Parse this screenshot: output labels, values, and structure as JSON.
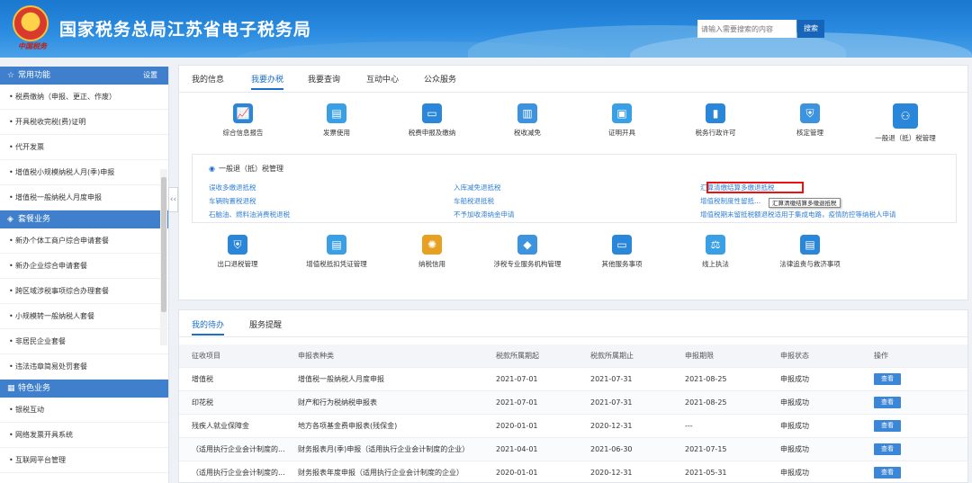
{
  "header": {
    "emblem_text": "中国税务",
    "title": "国家税务总局江苏省电子税务局",
    "search_placeholder": "请输入需要搜索的内容",
    "search_button": "搜索"
  },
  "sidebar": {
    "sections": [
      {
        "title": "常用功能",
        "right": "设置",
        "icon": "star-icon",
        "items": [
          "税费缴纳（申报、更正、作废）",
          "开具税收完税(费)证明",
          "代开发票",
          "增值税小规模纳税人月(季)申报",
          "增值税一般纳税人月度申报"
        ]
      },
      {
        "title": "套餐业务",
        "icon": "gem-icon",
        "items": [
          "新办个体工商户综合申请套餐",
          "新办企业综合申请套餐",
          "跨区域涉税事项综合办理套餐",
          "小规模转一般纳税人套餐",
          "非居民企业套餐",
          "违法违章简易处罚套餐"
        ]
      },
      {
        "title": "特色业务",
        "icon": "grid-icon",
        "items": [
          "银税互动",
          "网络发票开具系统",
          "互联网平台管理"
        ]
      }
    ]
  },
  "main": {
    "tabs": [
      "我的信息",
      "我要办税",
      "我要查询",
      "互动中心",
      "公众服务"
    ],
    "active_tab": 1,
    "functions_row1": [
      {
        "label": "综合信息报告",
        "icon": "report-icon",
        "color": "#2a86d8"
      },
      {
        "label": "发票使用",
        "icon": "invoice-icon",
        "color": "#3aa0e6"
      },
      {
        "label": "税费申报及缴纳",
        "icon": "monitor-icon",
        "color": "#2a86d8"
      },
      {
        "label": "税收减免",
        "icon": "chart-icon",
        "color": "#3c93e0"
      },
      {
        "label": "证明开具",
        "icon": "certificate-icon",
        "color": "#3aa0e6"
      },
      {
        "label": "税务行政许可",
        "icon": "license-icon",
        "color": "#2a86d8"
      },
      {
        "label": "核定管理",
        "icon": "shield-icon",
        "color": "#3c93e0"
      },
      {
        "label": "一般退（抵）税管理",
        "icon": "refund-icon",
        "color": "#2a86d8"
      }
    ],
    "sub": {
      "title": "一般退（抵）税管理",
      "links": [
        {
          "text": "误收多缴退抵税"
        },
        {
          "text": "入库减免退抵税"
        },
        {
          "text": "汇算清缴结算多缴退抵税"
        },
        {
          "text": "车辆购置税退税"
        },
        {
          "text": "车船税退抵税"
        },
        {
          "text": "增值税制度性留抵..."
        },
        {
          "text": "石脑油、燃料油消费税退税"
        },
        {
          "text": "不予加收滞纳金申请"
        },
        {
          "text": "增值税期末留抵税额退税适用于集成电路，疫情防控等纳税人申请"
        }
      ],
      "tooltip": "汇算清缴结算多缴退抵税"
    },
    "functions_row2": [
      {
        "label": "出口退税管理",
        "icon": "export-shield-icon",
        "color": "#2a86d8"
      },
      {
        "label": "增值税抵扣凭证管理",
        "icon": "voucher-icon",
        "color": "#3aa0e6"
      },
      {
        "label": "纳税信用",
        "icon": "credit-icon",
        "color": "#e8a020"
      },
      {
        "label": "涉税专业服务机构管理",
        "icon": "agency-icon",
        "color": "#3c93e0"
      },
      {
        "label": "其他服务事项",
        "icon": "other-icon",
        "color": "#2a86d8"
      },
      {
        "label": "线上执法",
        "icon": "law-icon",
        "color": "#3aa0e6"
      },
      {
        "label": "法律追责与救济事项",
        "icon": "legal-icon",
        "color": "#2a86d8"
      }
    ]
  },
  "todo": {
    "tabs": [
      "我的待办",
      "服务提醒"
    ],
    "columns": [
      "征收项目",
      "申报表种类",
      "税款所属期起",
      "税款所属期止",
      "申报期限",
      "申报状态",
      "操作"
    ],
    "rows": [
      [
        "增值税",
        "增值税一般纳税人月度申报",
        "2021-07-01",
        "2021-07-31",
        "2021-08-25",
        "申报成功",
        "查看"
      ],
      [
        "印花税",
        "财产和行为税纳税申报表",
        "2021-07-01",
        "2021-07-31",
        "2021-08-25",
        "申报成功",
        "查看"
      ],
      [
        "残疾人就业保障金",
        "地方各项基金费申报表(残保金)",
        "2020-01-01",
        "2020-12-31",
        "---",
        "申报成功",
        "查看"
      ],
      [
        "（适用执行企业会计制度的...",
        "财务报表月(季)申报（适用执行企业会计制度的企业）",
        "2021-04-01",
        "2021-06-30",
        "2021-07-15",
        "申报成功",
        "查看"
      ],
      [
        "（适用执行企业会计制度的...",
        "财务报表年度申报（适用执行企业会计制度的企业）",
        "2020-01-01",
        "2020-12-31",
        "2021-05-31",
        "申报成功",
        "查看"
      ]
    ]
  },
  "colors": {
    "primary": "#1b6fc8",
    "header": "#2a8be0",
    "highlight": "#e11111"
  }
}
